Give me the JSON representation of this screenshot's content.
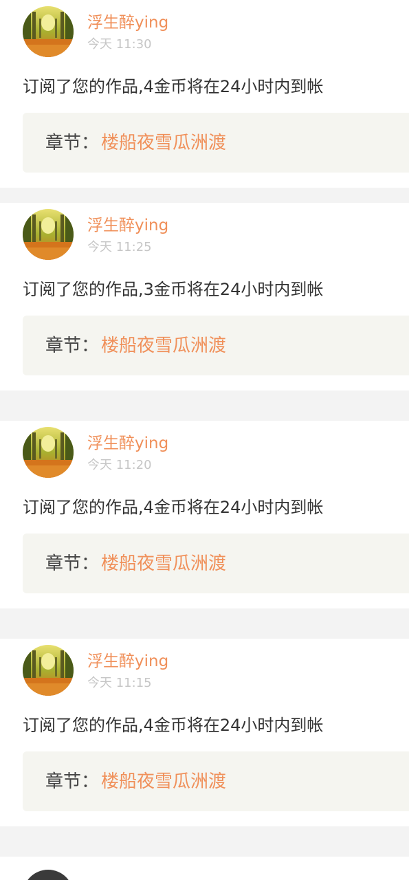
{
  "notifications": [
    {
      "username": "浮生醉ying",
      "time": "今天 11:30",
      "message": "订阅了您的作品,4金币将在24小时内到帐",
      "chapter_label": "章节：",
      "chapter_title": "楼船夜雪瓜洲渡"
    },
    {
      "username": "浮生醉ying",
      "time": "今天 11:25",
      "message": "订阅了您的作品,3金币将在24小时内到帐",
      "chapter_label": "章节：",
      "chapter_title": "楼船夜雪瓜洲渡"
    },
    {
      "username": "浮生醉ying",
      "time": "今天 11:20",
      "message": "订阅了您的作品,4金币将在24小时内到帐",
      "chapter_label": "章节：",
      "chapter_title": "楼船夜雪瓜洲渡"
    },
    {
      "username": "浮生醉ying",
      "time": "今天 11:15",
      "message": "订阅了您的作品,4金币将在24小时内到帐",
      "chapter_label": "章节：",
      "chapter_title": "楼船夜雪瓜洲渡"
    }
  ],
  "colors": {
    "accent": "#f0905a",
    "text": "#333333",
    "muted": "#c6c6c6",
    "chapter_bg": "#f5f5f0",
    "divider_bg": "#f3f3f3"
  },
  "icons": {
    "avatar": "autumn-forest-avatar-icon"
  }
}
